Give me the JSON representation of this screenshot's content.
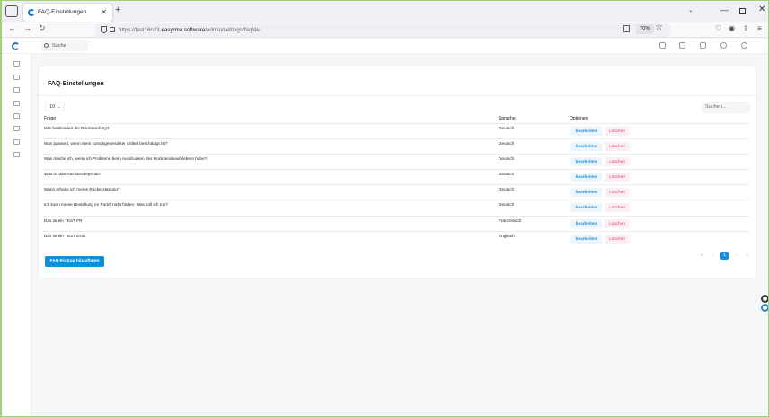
{
  "browser": {
    "tab_title": "FAQ-Einstellungen",
    "new_tab_icon": "plus-icon",
    "url_prefix": "https://test16n23.",
    "url_domain": "easyrma.software",
    "url_path": "/admin/settings/faq/de",
    "zoom": "70%"
  },
  "app": {
    "search_label": "Suche"
  },
  "page": {
    "title": "FAQ-Einstellungen",
    "page_length": "10",
    "search_placeholder": "Suchen...",
    "columns": {
      "question": "Frage",
      "language": "Sprache",
      "options": "Optionen"
    },
    "rows": [
      {
        "question": "Wie funktioniert die Rücksendung?",
        "language": "Deutsch",
        "edit": "bearbeiten",
        "delete": "Löschen"
      },
      {
        "question": "Was passiert, wenn mein zurückgesendeter Artikel beschädigt ist?",
        "language": "Deutsch",
        "edit": "bearbeiten",
        "delete": "Löschen"
      },
      {
        "question": "Was mache ich, wenn ich Probleme beim Ausdrucken des Rücksendeaufklebers habe?",
        "language": "Deutsch",
        "edit": "bearbeiten",
        "delete": "Löschen"
      },
      {
        "question": "Was ist das Rücksendeportal?",
        "language": "Deutsch",
        "edit": "bearbeiten",
        "delete": "Löschen"
      },
      {
        "question": "Wann erhalte ich meine Rückerstattung?",
        "language": "Deutsch",
        "edit": "bearbeiten",
        "delete": "Löschen"
      },
      {
        "question": "Ich kann meine Bestellung im Portal nicht finden. Was soll ich tun?",
        "language": "Deutsch",
        "edit": "bearbeiten",
        "delete": "Löschen"
      },
      {
        "question": "Das ist ein TEST FR",
        "language": "Französisch",
        "edit": "bearbeiten",
        "delete": "Löschen"
      },
      {
        "question": "Das ist ein TEST ENG",
        "language": "Englisch",
        "edit": "bearbeiten",
        "delete": "Löschen"
      }
    ],
    "pagination": {
      "first": "«",
      "prev": "‹",
      "current": "1",
      "next": "›",
      "last": "»"
    },
    "add_button": "FAQ-Eintrag hinzufügen"
  },
  "colors": {
    "primary": "#0f8fd8",
    "danger": "#e03b7a",
    "frame": "#9bd37a"
  }
}
